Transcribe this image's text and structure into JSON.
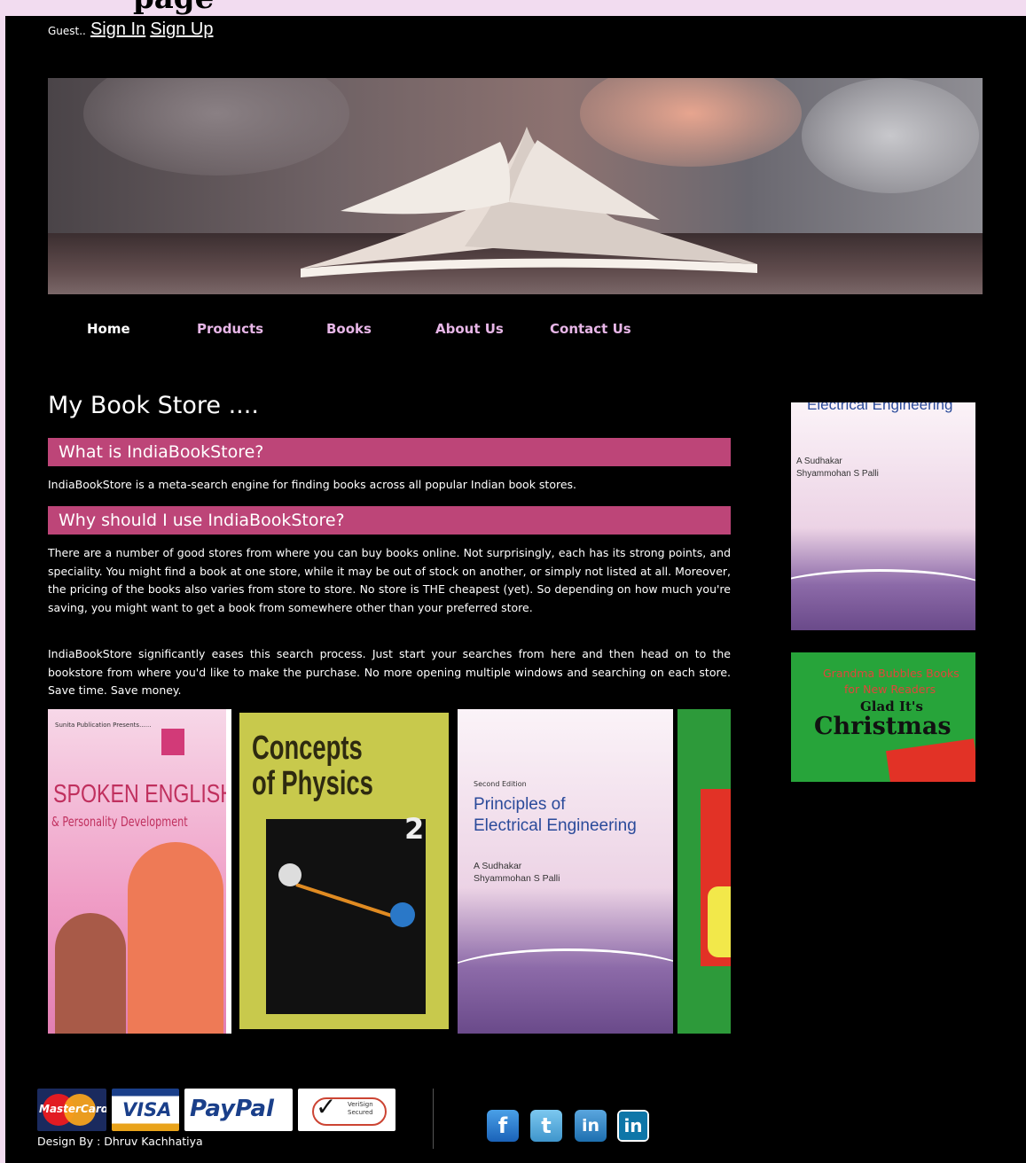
{
  "page": {
    "title_fragment": "page"
  },
  "guest_bar": {
    "greeting": "Guest..",
    "sign_in": "Sign In",
    "sign_up": "Sign Up"
  },
  "nav": [
    {
      "label": "Home"
    },
    {
      "label": "Products"
    },
    {
      "label": "Books"
    },
    {
      "label": "About Us"
    },
    {
      "label": "Contact Us"
    }
  ],
  "main": {
    "title": "My Book Store ....",
    "sections": [
      {
        "heading": "What is IndiaBookStore?",
        "paragraphs": [
          "IndiaBookStore is a meta-search engine for finding books across all popular Indian book stores."
        ]
      },
      {
        "heading": "Why should I use IndiaBookStore?",
        "paragraphs": [
          "There are a number of good stores from where you can buy books online. Not surprisingly, each has its strong points, and speciality. You might find a book at one store, while it may be out of stock on another, or simply not listed at all. Moreover, the pricing of the books also varies from store to store. No store is THE cheapest (yet). So depending on how much you're saving, you might want to get a book from somewhere other than your preferred store.",
          "IndiaBookStore significantly eases this search process. Just start your searches from here and then head on to the bookstore from where you'd like to make the purchase. No more opening multiple windows and searching on each store. Save time. Save money."
        ]
      }
    ]
  },
  "books": {
    "spoken": {
      "publisher": "Sunita Publication Presents......",
      "title": "SPOKEN ENGLISH",
      "subtitle": "& Personality Development"
    },
    "physics": {
      "line1": "Concepts",
      "line2": "of Physics",
      "volume": "2"
    },
    "electrical": {
      "edition": "Second Edition",
      "title_line1": "Principles of",
      "title_line2": "Electrical Engineering",
      "author1": "A Sudhakar",
      "author2": "Shyammohan S Palli"
    },
    "grandma": {
      "line1": "Grandma Bubbles Books",
      "line2": "for New Readers",
      "line3": "Glad It's",
      "line4": "Christmas"
    }
  },
  "sidebar": {
    "electrical": {
      "title": "Electrical Engineering",
      "author1": "A Sudhakar",
      "author2": "Shyammohan S Palli"
    }
  },
  "footer": {
    "cards": {
      "mastercard": "MasterCard",
      "visa": "VISA",
      "paypal": "PayPal",
      "verisign": "VeriSign Secured"
    },
    "designer": "Design By : Dhruv Kachhatiya",
    "social": {
      "facebook": "f",
      "twitter": "t",
      "linkedin1": "in",
      "linkedin2": "in"
    }
  },
  "colors": {
    "frame_bg": "#000000",
    "page_bg": "#f2dcf0",
    "section_head": "#bd4578",
    "nav_link": "#e7b6e7"
  }
}
